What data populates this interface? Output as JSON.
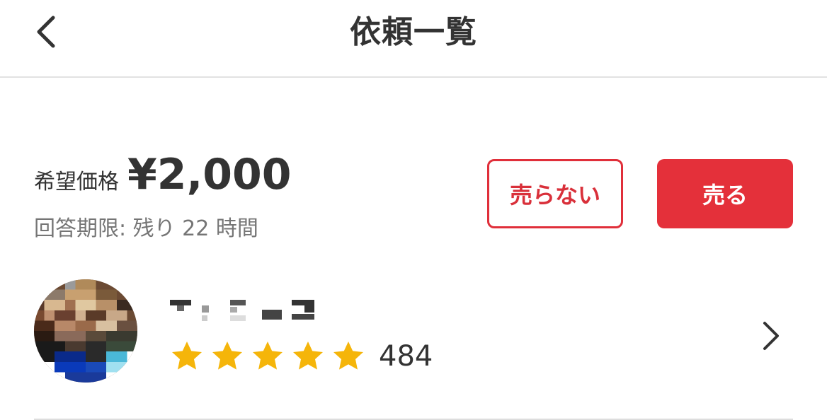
{
  "header": {
    "title": "依頼一覧",
    "back_icon": "chevron-left-icon"
  },
  "request": {
    "price_label": "希望価格",
    "price_value": "¥2,000",
    "deadline": "回答期限: 残り 22 時間"
  },
  "actions": {
    "decline_label": "売らない",
    "sell_label": "売る"
  },
  "seller": {
    "name_pixelated": true,
    "avatar_pixelated": true,
    "rating_stars": 5,
    "review_count": "484",
    "chevron_icon": "chevron-right-icon"
  },
  "colors": {
    "accent_red": "#e4303a",
    "star_yellow": "#f5b50a",
    "text_primary": "#333333",
    "text_secondary": "#757575",
    "divider": "#e2e2e2"
  }
}
